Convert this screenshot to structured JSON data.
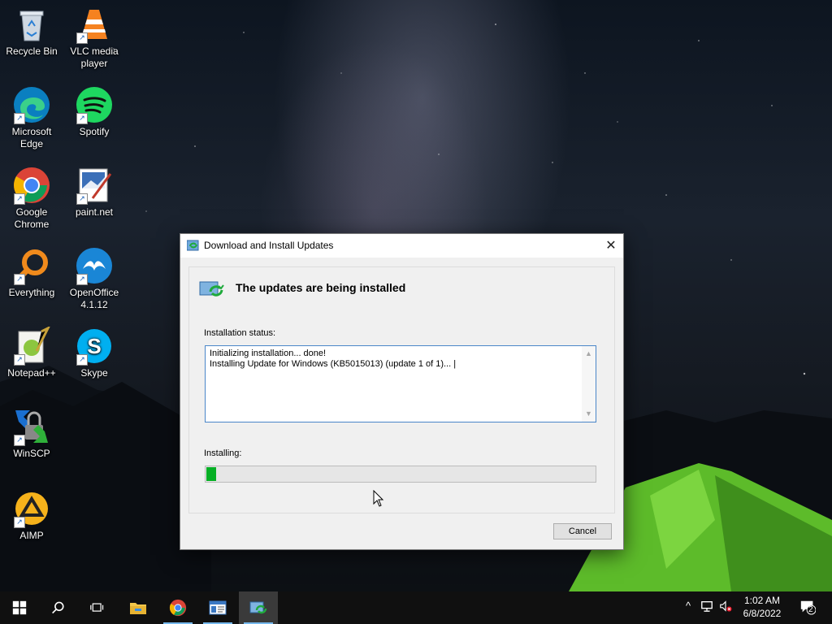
{
  "desktop_icons": [
    {
      "label": "Recycle Bin",
      "icon": "recycle-bin-icon"
    },
    {
      "label": "VLC media player",
      "icon": "vlc-icon"
    },
    {
      "label": "Microsoft Edge",
      "icon": "edge-icon"
    },
    {
      "label": "Spotify",
      "icon": "spotify-icon"
    },
    {
      "label": "Google Chrome",
      "icon": "chrome-icon"
    },
    {
      "label": "paint.net",
      "icon": "paintnet-icon"
    },
    {
      "label": "Everything",
      "icon": "everything-icon"
    },
    {
      "label": "OpenOffice 4.1.12",
      "icon": "openoffice-icon"
    },
    {
      "label": "Notepad++",
      "icon": "notepadpp-icon"
    },
    {
      "label": "Skype",
      "icon": "skype-icon"
    },
    {
      "label": "WinSCP",
      "icon": "winscp-icon"
    },
    {
      "label": "AIMP",
      "icon": "aimp-icon"
    }
  ],
  "dialog": {
    "title": "Download and Install Updates",
    "close_glyph": "✕",
    "header": "The updates are being installed",
    "status_label": "Installation status:",
    "log_lines": [
      "Initializing installation... done!",
      "Installing Update for Windows (KB5015013) (update 1 of 1)... |"
    ],
    "installing_label": "Installing:",
    "progress_fraction": 0.025,
    "progress_color": "#06b025",
    "cancel_label": "Cancel"
  },
  "taskbar": {
    "items": [
      "start-icon",
      "search-icon",
      "task-view-icon",
      "file-explorer-icon",
      "chrome-icon",
      "app-window-icon",
      "windows-update-icon"
    ],
    "tray": {
      "chevron": "^",
      "time": "1:02 AM",
      "date": "6/8/2022",
      "notification_count": "2"
    }
  },
  "colors": {
    "accent": "#76b9ed",
    "taskbar": "#101010"
  }
}
